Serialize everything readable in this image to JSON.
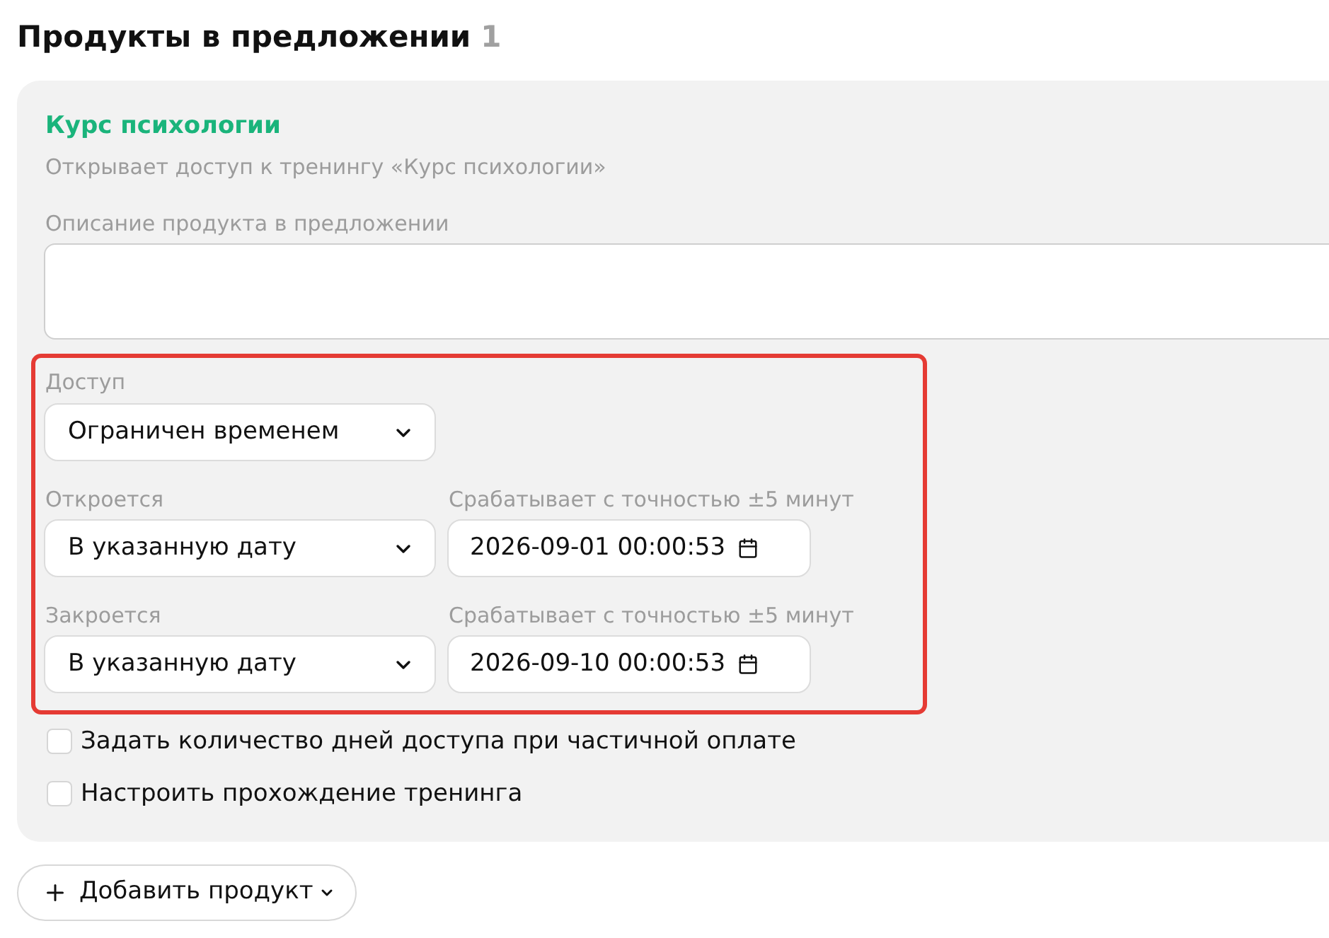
{
  "section": {
    "title": "Продукты в предложении",
    "count": "1"
  },
  "product": {
    "name": "Курс психологии",
    "subtitle": "Открывает доступ к тренингу «Курс психологии»",
    "description_label": "Описание продукта в предложении"
  },
  "access": {
    "highlighted": true,
    "label": "Доступ",
    "value": "Ограничен временем",
    "schedule": [
      {
        "label": "Откроется",
        "value": "В указанную дату",
        "hint": "Срабатывает с точностью ±5 минут",
        "datetime": "2026-09-01 00:00:53"
      },
      {
        "label": "Закроется",
        "value": "В указанную дату",
        "hint": "Срабатывает с точностью ±5 минут",
        "datetime": "2026-09-10 00:00:53"
      }
    ]
  },
  "options": [
    {
      "label": "Задать количество дней доступа при частичной оплате",
      "checked": false
    },
    {
      "label": "Настроить прохождение тренинга",
      "checked": false
    }
  ],
  "add_button": {
    "label": "Добавить продукт"
  }
}
